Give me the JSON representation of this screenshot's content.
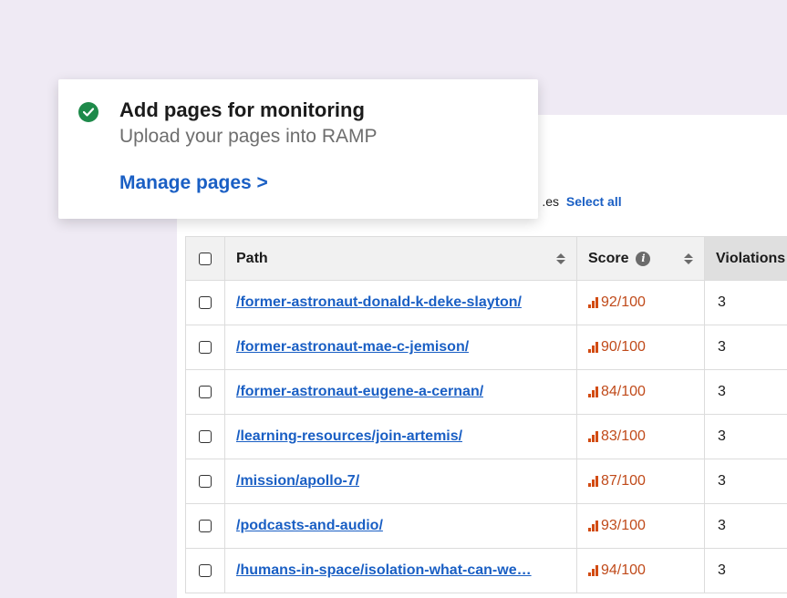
{
  "card": {
    "title": "Add pages for monitoring",
    "subtitle": "Upload your pages into RAMP",
    "link": "Manage pages >"
  },
  "selection": {
    "note_fragment": "es.",
    "select_all": "Select all"
  },
  "table": {
    "headers": {
      "path": "Path",
      "score": "Score",
      "violations": "Violations"
    },
    "rows": [
      {
        "path": "/former-astronaut-donald-k-deke-slayton/",
        "score": "92/100",
        "violations": "3"
      },
      {
        "path": "/former-astronaut-mae-c-jemison/",
        "score": "90/100",
        "violations": "3"
      },
      {
        "path": "/former-astronaut-eugene-a-cernan/",
        "score": "84/100",
        "violations": "3"
      },
      {
        "path": "/learning-resources/join-artemis/",
        "score": "83/100",
        "violations": "3"
      },
      {
        "path": "/mission/apollo-7/",
        "score": "87/100",
        "violations": "3"
      },
      {
        "path": "/podcasts-and-audio/",
        "score": "93/100",
        "violations": "3"
      },
      {
        "path": "/humans-in-space/isolation-what-can-we…",
        "score": "94/100",
        "violations": "3"
      }
    ]
  },
  "colors": {
    "accent": "#1a5fc4",
    "success": "#1e8a4a",
    "score": "#c04a1a",
    "background": "#efeaf4"
  },
  "icons": {
    "status": "check-circle-icon",
    "score": "bar-chart-icon",
    "info": "info-icon",
    "sort": "sort-icon"
  }
}
